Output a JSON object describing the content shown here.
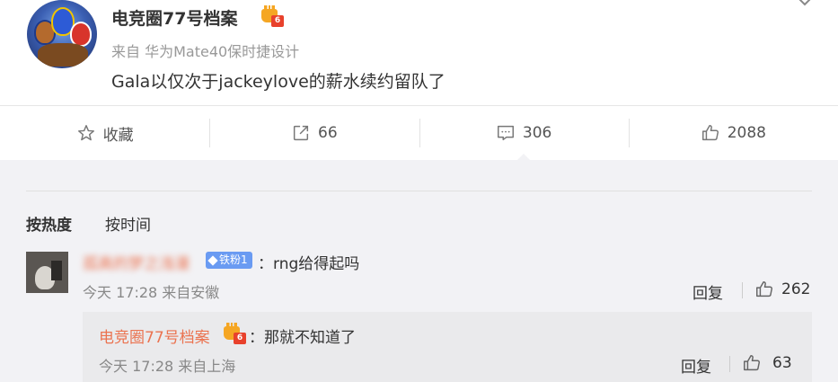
{
  "post": {
    "username": "电竞圈77号档案",
    "vip_badge_text": "6",
    "source": "来自 华为Mate40保时捷设计",
    "content": "Gala以仅次于jackeylove的薪水续约留队了"
  },
  "actions": {
    "favorite_label": "收藏",
    "repost_count": "66",
    "comment_count": "306",
    "like_count": "2088"
  },
  "comments": {
    "sort_hot": "按热度",
    "sort_time": "按时间",
    "items": [
      {
        "username": "孤高的梦之浅漫",
        "fan_badge": "铁粉1",
        "text": "：rng给得起吗",
        "meta": "今天 17:28 来自安徽",
        "reply_label": "回复",
        "like_count": "262",
        "replies": [
          {
            "username": "电竞圈77号档案",
            "vip_badge_text": "6",
            "text": "：那就不知道了",
            "meta": "今天 17:28 来自上海",
            "reply_label": "回复",
            "like_count": "63"
          }
        ]
      }
    ]
  },
  "colors": {
    "accent_name": "#eb7350",
    "fan_badge": "#6a9bf2",
    "vip_tag": "#e8412c",
    "background": "#f2f2f5"
  }
}
